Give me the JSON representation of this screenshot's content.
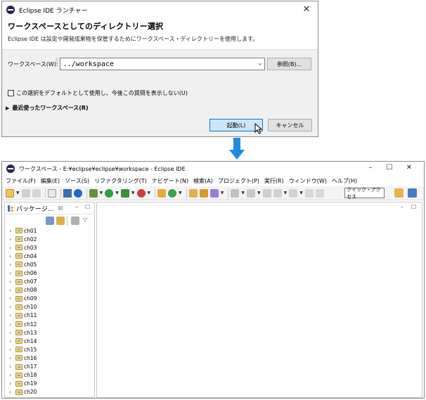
{
  "launcher": {
    "title": "Eclipse IDE ランチャー",
    "close_glyph": "✕",
    "heading": "ワークスペースとしてのディレクトリー選択",
    "description": "Eclipse IDE は設定や開発成果物を保管するためにワークスペース・ディレクトリーを使用します。",
    "workspace_label": "ワークスペース(W):",
    "workspace_value": "../workspace",
    "browse_label": "参照(B)...",
    "default_checkbox_label": "この選択をデフォルトとして使用し、今後この質問を表示しない(U)",
    "default_checked": false,
    "recent_label": "最近使ったワークスペース(R)",
    "launch_label": "起動(L)",
    "cancel_label": "キャンセル"
  },
  "ide": {
    "title": "ワークスペース - E:¥eclipse¥eclipse¥workspace - Eclipse IDE",
    "window_controls": [
      "–",
      "☐",
      "✕"
    ],
    "menu": [
      "ファイル(F)",
      "編集(E)",
      "ソース(S)",
      "リファクタリング(T)",
      "ナビゲート(N)",
      "検索(A)",
      "プロジェクト(P)",
      "実行(R)",
      "ウィンドウ(W)",
      "ヘルプ(H)"
    ],
    "quick_access": "クイック・アクセス",
    "package_explorer": {
      "tab_label": "パッケージ...",
      "close_glyph": "☒",
      "minimize_glyph": "–",
      "maximize_glyph": "☐",
      "projects": [
        "ch01",
        "ch02",
        "ch03",
        "ch04",
        "ch05",
        "ch06",
        "ch07",
        "ch08",
        "ch09",
        "ch10",
        "ch11",
        "ch12",
        "ch13",
        "ch14",
        "ch15",
        "ch16",
        "ch17",
        "ch18",
        "ch19",
        "ch20"
      ]
    },
    "editor": {
      "minimize_glyph": "–",
      "maximize_glyph": "☐"
    }
  },
  "colors": {
    "arrow": "#1e8be0",
    "launch_button_border": "#0078d7",
    "launch_button_fill": "#cce4f7"
  }
}
